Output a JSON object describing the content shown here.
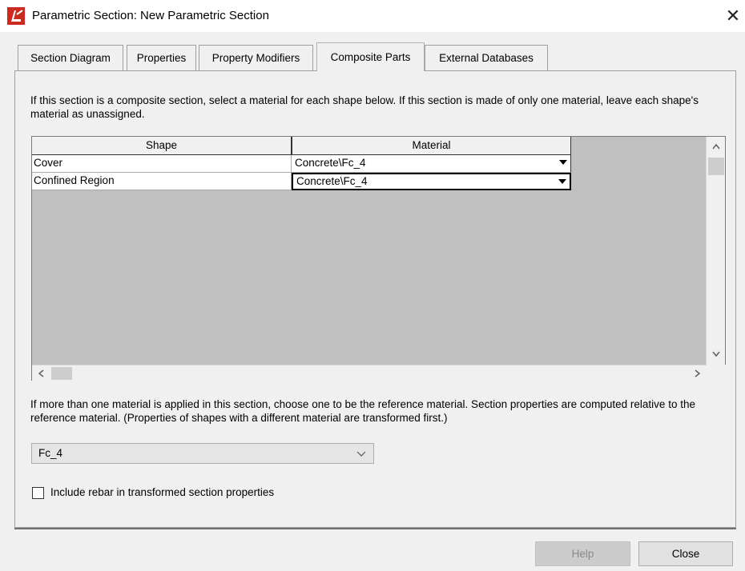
{
  "window": {
    "title": "Parametric Section: New Parametric Section",
    "close_glyph": "✕"
  },
  "tabs": [
    {
      "label": "Section Diagram"
    },
    {
      "label": "Properties"
    },
    {
      "label": "Property Modifiers"
    },
    {
      "label": "Composite Parts"
    },
    {
      "label": "External Databases"
    }
  ],
  "active_tab": "Composite Parts",
  "composite": {
    "description": "If this section is a composite section, select a material for each shape below.  If this section is made of only one material, leave each shape's material as unassigned.",
    "table": {
      "columns": [
        "Shape",
        "Material"
      ],
      "rows": [
        {
          "shape": "Cover",
          "material": "Concrete\\Fc_4"
        },
        {
          "shape": "Confined Region",
          "material": "Concrete\\Fc_4"
        }
      ]
    },
    "reference_description": "If more than one material is applied in this section, choose one to be the reference material. Section properties are computed relative to the reference material. (Properties of shapes with a different material are transformed first.)",
    "reference_material": "Fc_4",
    "include_rebar_label": "Include rebar in transformed section properties",
    "include_rebar_checked": false
  },
  "buttons": {
    "help": "Help",
    "close": "Close"
  },
  "icons": {
    "app": "etabs-logo-icon",
    "scroll_up": "▲",
    "scroll_down": "▼",
    "scroll_left": "◀",
    "scroll_right": "▶"
  },
  "colors": {
    "app_icon": "#cc2a1f",
    "grid_background": "#c0c0c0",
    "dialog_background": "#f0f0f0"
  }
}
